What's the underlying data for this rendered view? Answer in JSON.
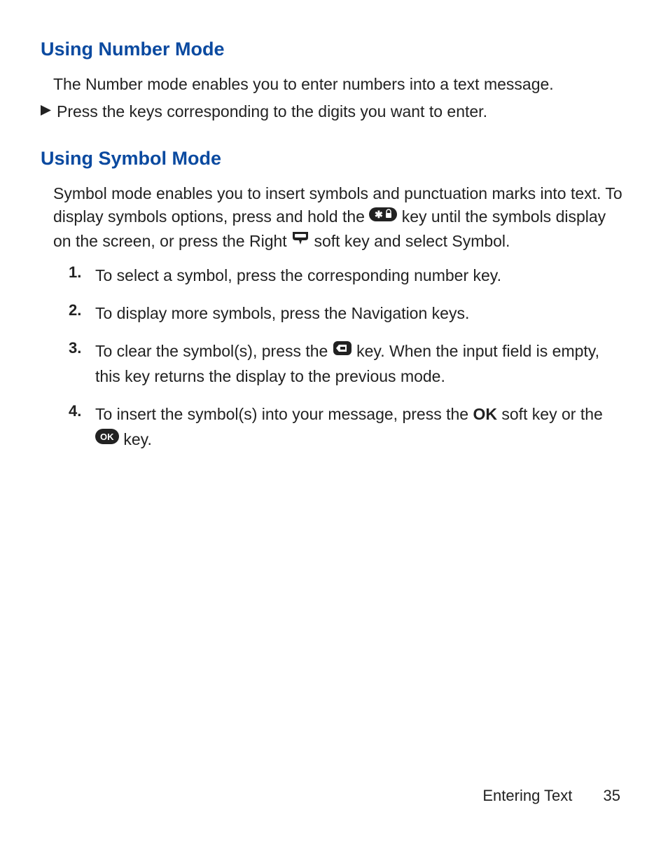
{
  "section1": {
    "heading": "Using Number Mode",
    "intro": "The Number mode enables you to enter numbers into a text message.",
    "bullet": "Press the keys corresponding to the digits you want to enter."
  },
  "section2": {
    "heading": "Using Symbol Mode",
    "intro_part1": "Symbol mode enables you to insert symbols and punctuation marks into text. To display symbols options, press and hold the ",
    "intro_part2": " key until the symbols display on the screen, or press the Right ",
    "intro_part3": " soft key and select Symbol.",
    "steps": {
      "s1": {
        "num": "1.",
        "text": "To select a symbol, press the corresponding number key."
      },
      "s2": {
        "num": "2.",
        "text": "To display more symbols, press the Navigation keys."
      },
      "s3": {
        "num": "3.",
        "pre": "To clear the symbol(s), press the ",
        "post": " key. When the input field is empty, this key returns the display to the previous mode."
      },
      "s4": {
        "num": "4.",
        "pre": "To insert the symbol(s) into your message, press the ",
        "ok": "OK",
        "mid": " soft key or the ",
        "post": " key."
      }
    }
  },
  "footer": {
    "section": "Entering Text",
    "page": "35"
  }
}
